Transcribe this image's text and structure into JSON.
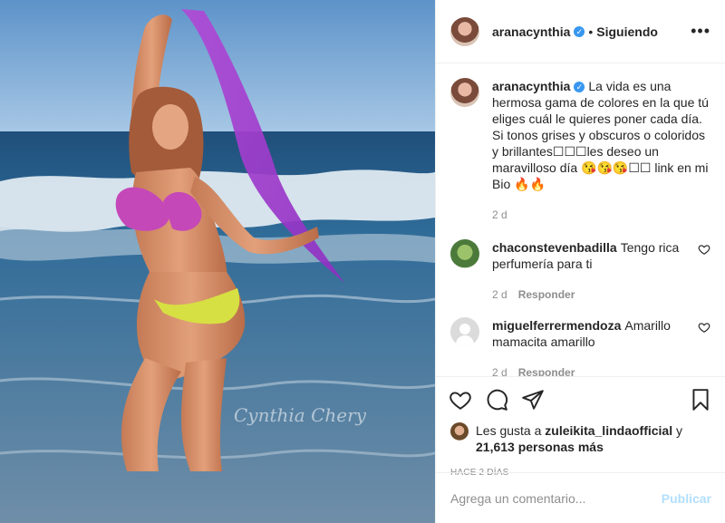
{
  "post": {
    "username": "aranacynthia",
    "verified_icon": "verified-badge-icon",
    "separator": "•",
    "follow_status": "Siguiendo",
    "more_label": "•••",
    "watermark": "Cynthia Chery"
  },
  "caption": {
    "username": "aranacynthia",
    "text": "La vida es una hermosa gama de colores en la que tú eliges cuál le quieres poner cada día. Si tonos grises y obscuros o coloridos y brillantes☐☐☐les deseo un maravilloso día 😘😘😘☐☐ link en mi Bio 🔥🔥",
    "time": "2 d"
  },
  "comments": [
    {
      "username": "chaconstevenbadilla",
      "text": "Tengo rica perfumería para ti",
      "time": "2 d",
      "reply": "Responder"
    },
    {
      "username": "miguelferrermendoza",
      "text": "Amarillo mamacita amarillo",
      "time": "2 d",
      "reply": "Responder"
    }
  ],
  "likes": {
    "prefix": "Les gusta a",
    "user": "zuleikita_lindaofficial",
    "and": "y",
    "count_text": "21,613 personas más"
  },
  "posted_ago": "HACE 2 DÍAS",
  "add_comment": {
    "placeholder": "Agrega un comentario...",
    "publish": "Publicar"
  },
  "colors": {
    "accent": "#3897f0",
    "publish_disabled": "#b2dffc",
    "muted": "#8e8e8e"
  }
}
